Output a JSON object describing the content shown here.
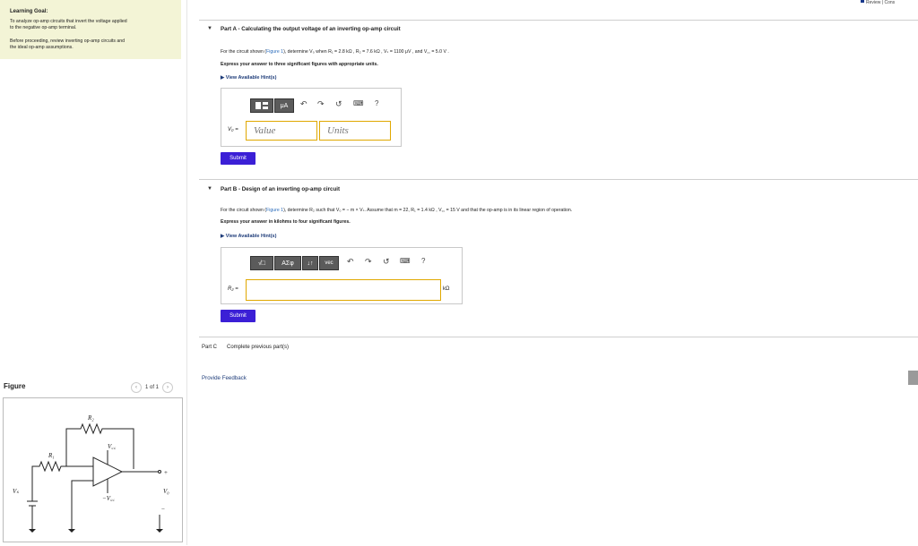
{
  "learning_goal": {
    "title": "Learning Goal:",
    "line1": "To analyze op-amp circuits that invert the voltage applied",
    "line2": "to the negative op-amp terminal.",
    "line3": "Before proceeding, review inverting op-amp circuits and",
    "line4": "the ideal op-amp assumptions."
  },
  "topbar": {
    "review": "Review | Cons"
  },
  "part_a": {
    "title": "Part A - Calculating the output voltage of an inverting op-amp circuit",
    "q_prefix": "For the circuit shown (",
    "q_figure_link": "Figure 1",
    "q_suffix": "), determine V₀ when R₁ = 2.8 kΩ , R₂ = 7.6 kΩ , Vₛ = 1100 μV , and V꜀꜀ = 5.0 V .",
    "instruction": "Express your answer to three significant figures with appropriate units.",
    "hint": "View Available Hint(s)",
    "tools": {
      "units": "μA",
      "help": "?"
    },
    "var_label": "V₀ =",
    "value_placeholder": "Value",
    "units_placeholder": "Units",
    "submit": "Submit"
  },
  "part_b": {
    "title": "Part B - Design of an inverting op-amp circuit",
    "q_prefix": "For the circuit shown (",
    "q_figure_link": "Figure 1",
    "q_suffix": "), determine R₂ such that V₀ = − m × Vₛ. Assume that m = 22, R₁ = 1.4 kΩ , V꜀꜀ = 15 V and that the op-amp is in its linear region of operation.",
    "instruction": "Express your answer in kilohms to four significant figures.",
    "hint": "View Available Hint(s)",
    "tools": {
      "templates": "√□",
      "greek": "ΑΣφ",
      "arrows": "↓↑",
      "vec": "vec",
      "help": "?"
    },
    "var_label": "R₂ =",
    "unit": "kΩ",
    "submit": "Submit"
  },
  "part_c": {
    "label": "Part C",
    "text": "Complete previous part(s)"
  },
  "feedback": "Provide Feedback",
  "figure": {
    "title": "Figure",
    "pager": "1 of 1",
    "labels": {
      "r2": "R₂",
      "r1": "R₁",
      "vcc_pos": "V꜀꜀",
      "vcc_neg": "−V꜀꜀",
      "vs": "Vₛ",
      "vo": "V₀",
      "plus": "+",
      "minus": "−"
    }
  }
}
